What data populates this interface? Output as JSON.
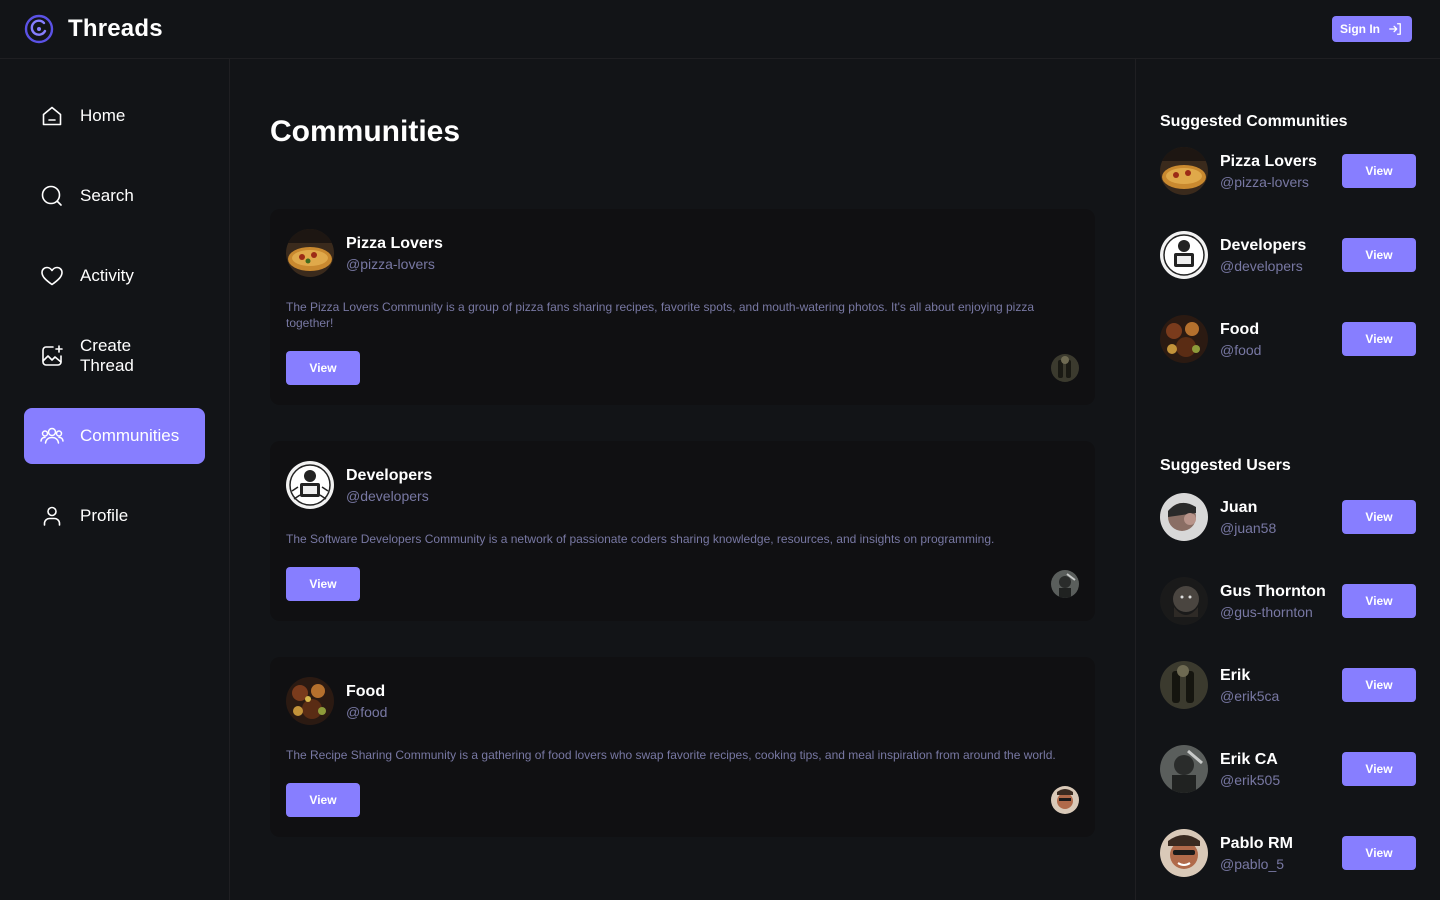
{
  "app": {
    "name": "Threads",
    "signin_label": "Sign In"
  },
  "colors": {
    "accent": "#877eff",
    "bg": "#121417",
    "card": "#101012",
    "muted": "#7878a3"
  },
  "sidebar": {
    "items": [
      {
        "label": "Home",
        "icon": "home-icon"
      },
      {
        "label": "Search",
        "icon": "search-icon"
      },
      {
        "label": "Activity",
        "icon": "heart-icon"
      },
      {
        "label": "Create Thread",
        "icon": "create-thread-icon"
      },
      {
        "label": "Communities",
        "icon": "communities-icon",
        "active": true
      },
      {
        "label": "Profile",
        "icon": "user-icon"
      }
    ]
  },
  "main": {
    "title": "Communities",
    "communities": [
      {
        "name": "Pizza Lovers",
        "handle": "@pizza-lovers",
        "bio": "The Pizza Lovers Community is a group of pizza fans sharing recipes, favorite spots, and mouth-watering photos. It's all about enjoying pizza together!",
        "view_label": "View"
      },
      {
        "name": "Developers",
        "handle": "@developers",
        "bio": "The Software Developers Community is a network of passionate coders sharing knowledge, resources, and insights on programming.",
        "view_label": "View"
      },
      {
        "name": "Food",
        "handle": "@food",
        "bio": "The Recipe Sharing Community is a gathering of food lovers who swap favorite recipes, cooking tips, and meal inspiration from around the world.",
        "view_label": "View"
      }
    ]
  },
  "right": {
    "communities_title": "Suggested Communities",
    "communities": [
      {
        "name": "Pizza Lovers",
        "handle": "@pizza-lovers",
        "view_label": "View"
      },
      {
        "name": "Developers",
        "handle": "@developers",
        "view_label": "View"
      },
      {
        "name": "Food",
        "handle": "@food",
        "view_label": "View"
      }
    ],
    "users_title": "Suggested Users",
    "users": [
      {
        "name": "Juan",
        "handle": "@juan58",
        "view_label": "View"
      },
      {
        "name": "Gus Thornton",
        "handle": "@gus-thornton",
        "view_label": "View"
      },
      {
        "name": "Erik",
        "handle": "@erik5ca",
        "view_label": "View"
      },
      {
        "name": "Erik CA",
        "handle": "@erik505",
        "view_label": "View"
      },
      {
        "name": "Pablo RM",
        "handle": "@pablo_5",
        "view_label": "View"
      }
    ]
  }
}
